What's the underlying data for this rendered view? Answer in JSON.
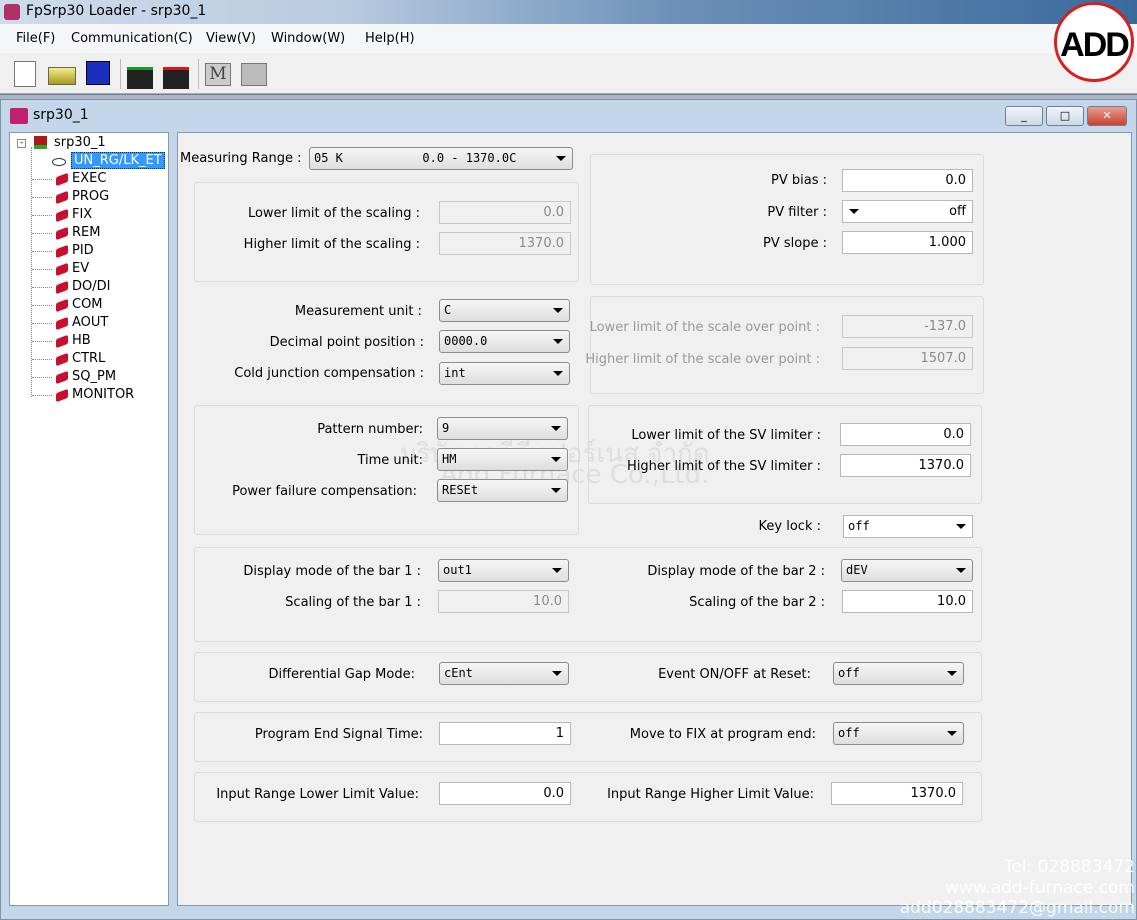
{
  "app": {
    "title": "FpSrp30 Loader - srp30_1"
  },
  "menu": [
    "File(F)",
    "Communication(C)",
    "View(V)",
    "Window(W)",
    "Help(H)"
  ],
  "toolbar": [
    "new-file-icon",
    "open-folder-icon",
    "save-icon",
    "upload-to-device-icon",
    "download-from-device-icon",
    "monitor-m-icon",
    "tool-icon"
  ],
  "child_window": {
    "title": "srp30_1",
    "buttons": [
      "_",
      "□",
      "✕"
    ]
  },
  "tree": {
    "root": "srp30_1",
    "selected": "UN_RG/LK_ET",
    "items": [
      "EXEC",
      "PROG",
      "FIX",
      "REM",
      "PID",
      "EV",
      "DO/DI",
      "COM",
      "AOUT",
      "HB",
      "CTRL",
      "SQ_PM",
      "MONITOR"
    ]
  },
  "form": {
    "measuring_range": {
      "label": "Measuring Range :",
      "value": "05 K           0.0 - 1370.0C"
    },
    "lower_scaling": {
      "label": "Lower limit of the scaling :",
      "value": "0.0"
    },
    "higher_scaling": {
      "label": "Higher limit of the scaling :",
      "value": "1370.0"
    },
    "pv_bias": {
      "label": "PV bias :",
      "value": "0.0"
    },
    "pv_filter": {
      "label": "PV filter :",
      "value": "off"
    },
    "pv_slope": {
      "label": "PV slope :",
      "value": "1.000"
    },
    "measurement_unit": {
      "label": "Measurement unit :",
      "value": "C"
    },
    "decimal_point": {
      "label": "Decimal point position :",
      "value": "0000.0"
    },
    "cold_junction": {
      "label": "Cold junction compensation :",
      "value": "int"
    },
    "lower_scale_over": {
      "label": "Lower limit of the scale over point :",
      "value": "-137.0"
    },
    "higher_scale_over": {
      "label": "Higher limit of the scale over point :",
      "value": "1507.0"
    },
    "pattern_number": {
      "label": "Pattern number:",
      "value": "9"
    },
    "time_unit": {
      "label": "Time unit:",
      "value": "HM"
    },
    "power_failure": {
      "label": "Power failure compensation:",
      "value": "RESEt"
    },
    "lower_sv": {
      "label": "Lower limit of the SV limiter :",
      "value": "0.0"
    },
    "higher_sv": {
      "label": "Higher limit of the SV limiter :",
      "value": "1370.0"
    },
    "key_lock": {
      "label": "Key lock :",
      "value": "off"
    },
    "bar1_mode": {
      "label": "Display mode of the bar 1 :",
      "value": "out1"
    },
    "bar1_scaling": {
      "label": "Scaling of the bar 1 :",
      "value": "10.0"
    },
    "bar2_mode": {
      "label": "Display mode of the bar 2 :",
      "value": "dEV"
    },
    "bar2_scaling": {
      "label": "Scaling of the bar 2 :",
      "value": "10.0"
    },
    "diff_gap": {
      "label": "Differential Gap Mode:",
      "value": "cEnt"
    },
    "event_reset": {
      "label": "Event ON/OFF at Reset:",
      "value": "off"
    },
    "prog_end_time": {
      "label": "Program End Signal Time:",
      "value": "1"
    },
    "move_fix": {
      "label": "Move to FIX at program end:",
      "value": "off"
    },
    "input_lower": {
      "label": "Input Range Lower Limit Value:",
      "value": "0.0"
    },
    "input_higher": {
      "label": "Input Range Higher Limit Value:",
      "value": "1370.0"
    }
  },
  "watermark": {
    "logo": "ADD",
    "company_thai": "บริษัท เอดีดี เฟอร์เนส จำกัด",
    "company": "Add Furnace Co.,Ltd.",
    "tel": "Tel: 028883472",
    "web": "www.add-furnace.com",
    "email": "add028883472@gmail.com"
  },
  "colors": {
    "selection": "#3399ff",
    "tree_icon": "#c8102e",
    "logo_ring": "#d62020"
  }
}
